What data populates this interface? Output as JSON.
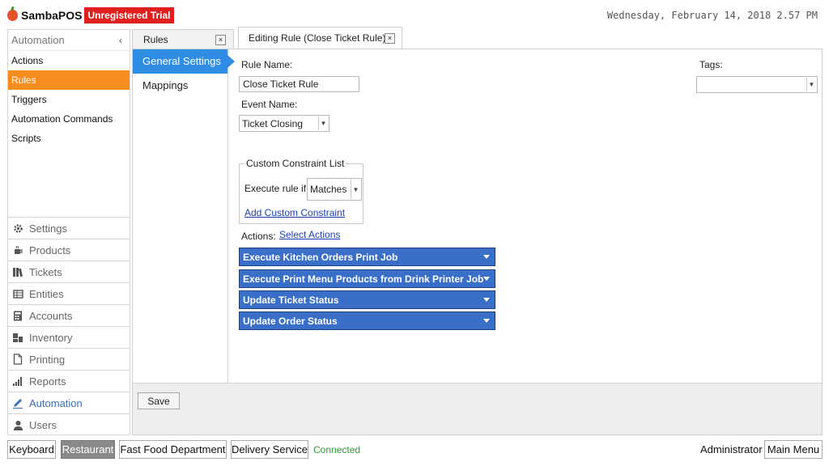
{
  "header": {
    "app_name": "SambaPOS",
    "trial_badge": "Unregistered Trial",
    "datetime": "Wednesday, February 14, 2018 2.57 PM"
  },
  "left_nav": {
    "title": "Automation",
    "collapse_glyph": "‹",
    "sub_items": [
      "Actions",
      "Rules",
      "Triggers",
      "Automation Commands",
      "Scripts"
    ],
    "active_sub_item": "Rules",
    "sections": [
      {
        "label": "Settings",
        "icon": "gear-icon"
      },
      {
        "label": "Products",
        "icon": "coffee-cup-icon"
      },
      {
        "label": "Tickets",
        "icon": "books-icon"
      },
      {
        "label": "Entities",
        "icon": "table-icon"
      },
      {
        "label": "Accounts",
        "icon": "calculator-icon"
      },
      {
        "label": "Inventory",
        "icon": "boxes-icon"
      },
      {
        "label": "Printing",
        "icon": "document-icon"
      },
      {
        "label": "Reports",
        "icon": "bar-chart-icon"
      },
      {
        "label": "Automation",
        "icon": "pen-icon"
      },
      {
        "label": "Users",
        "icon": "user-icon"
      }
    ],
    "selected_section": "Automation"
  },
  "tabs": {
    "rules_tab": "Rules",
    "editing_tab": "Editing Rule (Close Ticket Rule)",
    "close_glyph": "×"
  },
  "vertical_tabs": [
    "General Settings",
    "Mappings"
  ],
  "form": {
    "rule_name_label": "Rule Name:",
    "rule_name_value": "Close Ticket Rule",
    "event_name_label": "Event Name:",
    "event_name_value": "Ticket Closing",
    "tags_label": "Tags:",
    "tags_value": "",
    "constraint_legend": "Custom Constraint List",
    "execute_rule_label": "Execute rule if",
    "execute_rule_value": "Matches",
    "add_constraint_link": "Add Custom Constraint",
    "actions_label": "Actions:",
    "select_actions_link": "Select Actions",
    "actions": [
      "Execute Kitchen Orders Print Job",
      "Execute Print Menu Products from Drink Printer Job",
      "Update Ticket Status",
      "Update Order Status"
    ],
    "save_label": "Save"
  },
  "footer": {
    "buttons": [
      "Keyboard",
      "Restaurant",
      "Fast Food Department",
      "Delivery Service"
    ],
    "active_button": "Restaurant",
    "connection_status": "Connected",
    "user": "Administrator",
    "main_menu": "Main Menu"
  },
  "colors": {
    "accent_orange": "#f58c1f",
    "tab_blue": "#2f8de4",
    "action_blue": "#3a6fc9",
    "trial_red": "#e01f1f",
    "connected_green": "#2f9a2f"
  }
}
